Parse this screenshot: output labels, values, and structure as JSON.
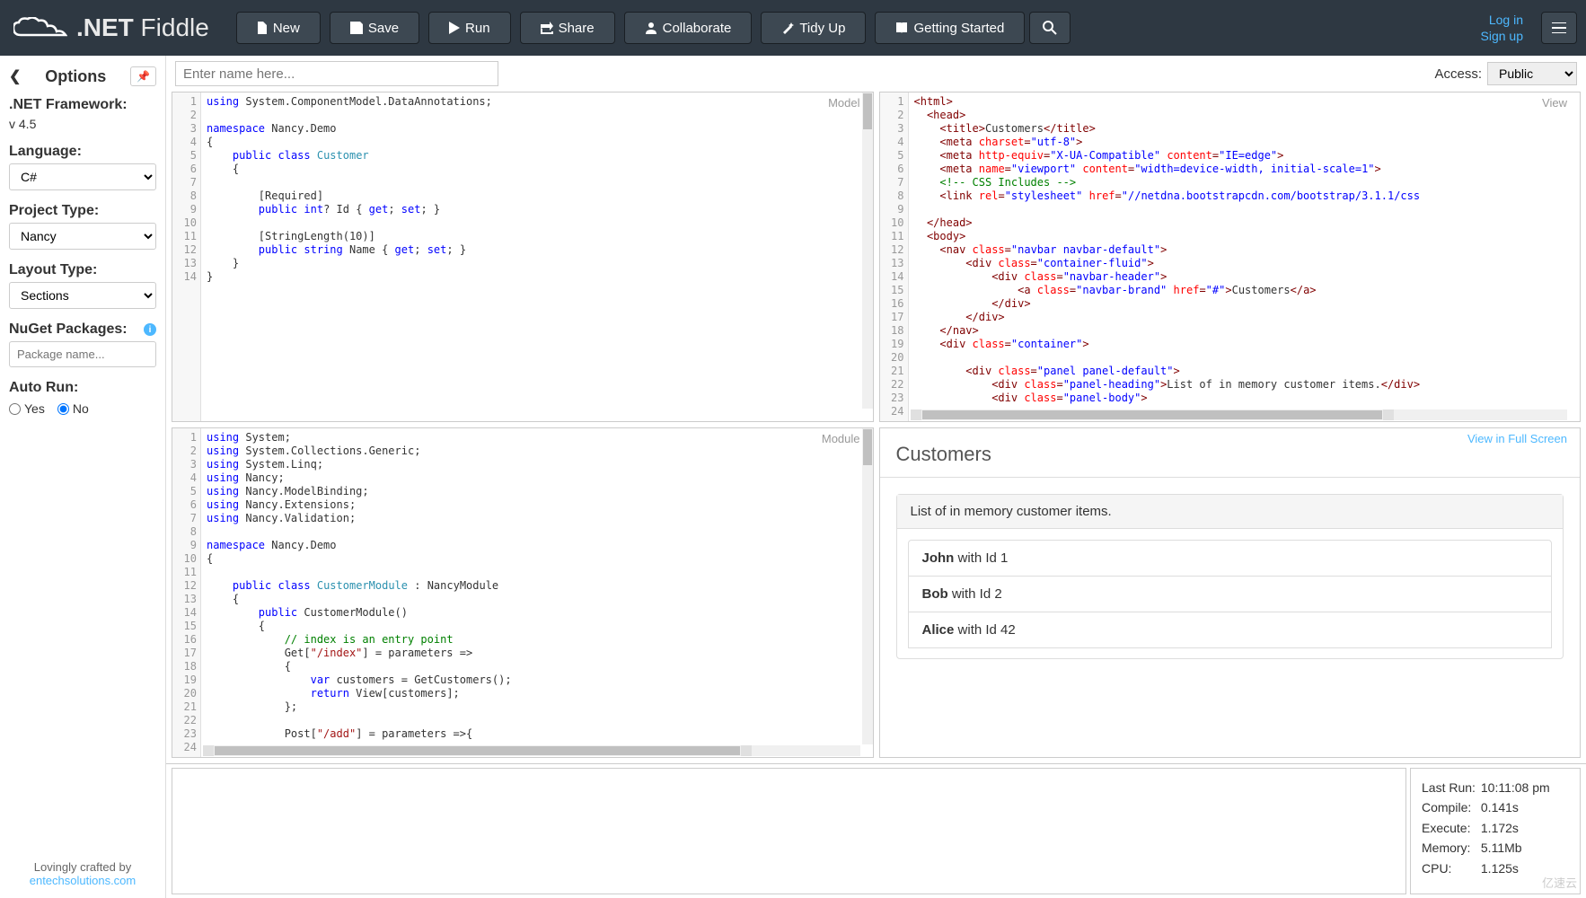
{
  "brand": {
    "name_prefix": ".NET",
    "name_suffix": " Fiddle"
  },
  "nav": {
    "new": "New",
    "save": "Save",
    "run": "Run",
    "share": "Share",
    "collaborate": "Collaborate",
    "tidyup": "Tidy Up",
    "getting_started": "Getting Started",
    "login": "Log in",
    "signup": "Sign up"
  },
  "sidebar": {
    "title": "Options",
    "framework_label": ".NET Framework:",
    "framework_value": "v 4.5",
    "language_label": "Language:",
    "language_value": "C#",
    "project_type_label": "Project Type:",
    "project_type_value": "Nancy",
    "layout_type_label": "Layout Type:",
    "layout_type_value": "Sections",
    "nuget_label": "NuGet Packages:",
    "nuget_placeholder": "Package name...",
    "autorun_label": "Auto Run:",
    "autorun_yes": "Yes",
    "autorun_no": "No",
    "footer_text": "Lovingly crafted by",
    "footer_link": "entechsolutions.com"
  },
  "topbar": {
    "name_placeholder": "Enter name here...",
    "access_label": "Access:",
    "access_value": "Public"
  },
  "panes": {
    "model_label": "Model",
    "view_label": "View",
    "module_label": "Module",
    "fullscreen_label": "View in Full Screen"
  },
  "model_code": [
    {
      "t": [
        [
          "kw",
          "using"
        ],
        [
          "",
          " System.ComponentModel.DataAnnotations;"
        ]
      ]
    },
    {
      "t": [
        [
          "",
          ""
        ]
      ]
    },
    {
      "t": [
        [
          "kw",
          "namespace"
        ],
        [
          "",
          " Nancy.Demo"
        ]
      ]
    },
    {
      "t": [
        [
          "",
          "{"
        ]
      ]
    },
    {
      "t": [
        [
          "",
          "    "
        ],
        [
          "kw",
          "public"
        ],
        [
          "",
          " "
        ],
        [
          "kw",
          "class"
        ],
        [
          "",
          " "
        ],
        [
          "typ",
          "Customer"
        ]
      ]
    },
    {
      "t": [
        [
          "",
          "    {"
        ]
      ]
    },
    {
      "t": [
        [
          "",
          ""
        ]
      ]
    },
    {
      "t": [
        [
          "",
          "        [Required]"
        ]
      ]
    },
    {
      "t": [
        [
          "",
          "        "
        ],
        [
          "kw",
          "public"
        ],
        [
          "",
          " "
        ],
        [
          "kw",
          "int"
        ],
        [
          "",
          "? Id { "
        ],
        [
          "kw",
          "get"
        ],
        [
          "",
          "; "
        ],
        [
          "kw",
          "set"
        ],
        [
          "",
          "; }"
        ]
      ]
    },
    {
      "t": [
        [
          "",
          ""
        ]
      ]
    },
    {
      "t": [
        [
          "",
          "        [StringLength(10)]"
        ]
      ]
    },
    {
      "t": [
        [
          "",
          "        "
        ],
        [
          "kw",
          "public"
        ],
        [
          "",
          " "
        ],
        [
          "kw",
          "string"
        ],
        [
          "",
          " Name { "
        ],
        [
          "kw",
          "get"
        ],
        [
          "",
          "; "
        ],
        [
          "kw",
          "set"
        ],
        [
          "",
          "; }"
        ]
      ]
    },
    {
      "t": [
        [
          "",
          "    }"
        ]
      ]
    },
    {
      "t": [
        [
          "",
          "}"
        ]
      ]
    }
  ],
  "view_code": [
    {
      "t": [
        [
          "tag",
          "<html>"
        ]
      ]
    },
    {
      "t": [
        [
          "",
          "  "
        ],
        [
          "tag",
          "<head>"
        ]
      ]
    },
    {
      "t": [
        [
          "",
          "    "
        ],
        [
          "tag",
          "<title>"
        ],
        [
          "",
          "Customers"
        ],
        [
          "tag",
          "</title>"
        ]
      ]
    },
    {
      "t": [
        [
          "",
          "    "
        ],
        [
          "tag",
          "<meta "
        ],
        [
          "attn",
          "charset"
        ],
        [
          "tag",
          "="
        ],
        [
          "attv",
          "\"utf-8\""
        ],
        [
          "tag",
          ">"
        ]
      ]
    },
    {
      "t": [
        [
          "",
          "    "
        ],
        [
          "tag",
          "<meta "
        ],
        [
          "attn",
          "http-equiv"
        ],
        [
          "tag",
          "="
        ],
        [
          "attv",
          "\"X-UA-Compatible\""
        ],
        [
          "tag",
          " "
        ],
        [
          "attn",
          "content"
        ],
        [
          "tag",
          "="
        ],
        [
          "attv",
          "\"IE=edge\""
        ],
        [
          "tag",
          ">"
        ]
      ]
    },
    {
      "t": [
        [
          "",
          "    "
        ],
        [
          "tag",
          "<meta "
        ],
        [
          "attn",
          "name"
        ],
        [
          "tag",
          "="
        ],
        [
          "attv",
          "\"viewport\""
        ],
        [
          "tag",
          " "
        ],
        [
          "attn",
          "content"
        ],
        [
          "tag",
          "="
        ],
        [
          "attv",
          "\"width=device-width, initial-scale=1\""
        ],
        [
          "tag",
          ">"
        ]
      ]
    },
    {
      "t": [
        [
          "",
          "    "
        ],
        [
          "com",
          "<!-- CSS Includes -->"
        ]
      ]
    },
    {
      "t": [
        [
          "",
          "    "
        ],
        [
          "tag",
          "<link "
        ],
        [
          "attn",
          "rel"
        ],
        [
          "tag",
          "="
        ],
        [
          "attv",
          "\"stylesheet\""
        ],
        [
          "tag",
          " "
        ],
        [
          "attn",
          "href"
        ],
        [
          "tag",
          "="
        ],
        [
          "attv",
          "\"//netdna.bootstrapcdn.com/bootstrap/3.1.1/css"
        ]
      ]
    },
    {
      "t": [
        [
          "",
          ""
        ]
      ]
    },
    {
      "t": [
        [
          "",
          "  "
        ],
        [
          "tag",
          "</head>"
        ]
      ]
    },
    {
      "t": [
        [
          "",
          "  "
        ],
        [
          "tag",
          "<body>"
        ]
      ]
    },
    {
      "t": [
        [
          "",
          "    "
        ],
        [
          "tag",
          "<nav "
        ],
        [
          "attn",
          "class"
        ],
        [
          "tag",
          "="
        ],
        [
          "attv",
          "\"navbar navbar-default\""
        ],
        [
          "tag",
          ">"
        ]
      ]
    },
    {
      "t": [
        [
          "",
          "        "
        ],
        [
          "tag",
          "<div "
        ],
        [
          "attn",
          "class"
        ],
        [
          "tag",
          "="
        ],
        [
          "attv",
          "\"container-fluid\""
        ],
        [
          "tag",
          ">"
        ]
      ]
    },
    {
      "t": [
        [
          "",
          "            "
        ],
        [
          "tag",
          "<div "
        ],
        [
          "attn",
          "class"
        ],
        [
          "tag",
          "="
        ],
        [
          "attv",
          "\"navbar-header\""
        ],
        [
          "tag",
          ">"
        ]
      ]
    },
    {
      "t": [
        [
          "",
          "                "
        ],
        [
          "tag",
          "<a "
        ],
        [
          "attn",
          "class"
        ],
        [
          "tag",
          "="
        ],
        [
          "attv",
          "\"navbar-brand\""
        ],
        [
          "tag",
          " "
        ],
        [
          "attn",
          "href"
        ],
        [
          "tag",
          "="
        ],
        [
          "attv",
          "\"#\""
        ],
        [
          "tag",
          ">"
        ],
        [
          "",
          "Customers"
        ],
        [
          "tag",
          "</a>"
        ]
      ]
    },
    {
      "t": [
        [
          "",
          "            "
        ],
        [
          "tag",
          "</div>"
        ]
      ]
    },
    {
      "t": [
        [
          "",
          "        "
        ],
        [
          "tag",
          "</div>"
        ]
      ]
    },
    {
      "t": [
        [
          "",
          "    "
        ],
        [
          "tag",
          "</nav>"
        ]
      ]
    },
    {
      "t": [
        [
          "",
          "    "
        ],
        [
          "tag",
          "<div "
        ],
        [
          "attn",
          "class"
        ],
        [
          "tag",
          "="
        ],
        [
          "attv",
          "\"container\""
        ],
        [
          "tag",
          ">"
        ]
      ]
    },
    {
      "t": [
        [
          "",
          ""
        ]
      ]
    },
    {
      "t": [
        [
          "",
          "        "
        ],
        [
          "tag",
          "<div "
        ],
        [
          "attn",
          "class"
        ],
        [
          "tag",
          "="
        ],
        [
          "attv",
          "\"panel panel-default\""
        ],
        [
          "tag",
          ">"
        ]
      ]
    },
    {
      "t": [
        [
          "",
          "            "
        ],
        [
          "tag",
          "<div "
        ],
        [
          "attn",
          "class"
        ],
        [
          "tag",
          "="
        ],
        [
          "attv",
          "\"panel-heading\""
        ],
        [
          "tag",
          ">"
        ],
        [
          "",
          "List of in memory customer items."
        ],
        [
          "tag",
          "</div>"
        ]
      ]
    },
    {
      "t": [
        [
          "",
          "            "
        ],
        [
          "tag",
          "<div "
        ],
        [
          "attn",
          "class"
        ],
        [
          "tag",
          "="
        ],
        [
          "attv",
          "\"panel-body\""
        ],
        [
          "tag",
          ">"
        ]
      ]
    },
    {
      "t": [
        [
          "",
          ""
        ]
      ]
    }
  ],
  "module_code": [
    {
      "t": [
        [
          "kw",
          "using"
        ],
        [
          "",
          " System;"
        ]
      ]
    },
    {
      "t": [
        [
          "kw",
          "using"
        ],
        [
          "",
          " System.Collections.Generic;"
        ]
      ]
    },
    {
      "t": [
        [
          "kw",
          "using"
        ],
        [
          "",
          " System.Linq;"
        ]
      ]
    },
    {
      "t": [
        [
          "kw",
          "using"
        ],
        [
          "",
          " Nancy;"
        ]
      ]
    },
    {
      "t": [
        [
          "kw",
          "using"
        ],
        [
          "",
          " Nancy.ModelBinding;"
        ]
      ]
    },
    {
      "t": [
        [
          "kw",
          "using"
        ],
        [
          "",
          " Nancy.Extensions;"
        ]
      ]
    },
    {
      "t": [
        [
          "kw",
          "using"
        ],
        [
          "",
          " Nancy.Validation;"
        ]
      ]
    },
    {
      "t": [
        [
          "",
          ""
        ]
      ]
    },
    {
      "t": [
        [
          "kw",
          "namespace"
        ],
        [
          "",
          " Nancy.Demo"
        ]
      ]
    },
    {
      "t": [
        [
          "",
          "{"
        ]
      ]
    },
    {
      "t": [
        [
          "",
          ""
        ]
      ]
    },
    {
      "t": [
        [
          "",
          "    "
        ],
        [
          "kw",
          "public"
        ],
        [
          "",
          " "
        ],
        [
          "kw",
          "class"
        ],
        [
          "",
          " "
        ],
        [
          "typ",
          "CustomerModule"
        ],
        [
          "",
          " : NancyModule"
        ]
      ]
    },
    {
      "t": [
        [
          "",
          "    {"
        ]
      ]
    },
    {
      "t": [
        [
          "",
          "        "
        ],
        [
          "kw",
          "public"
        ],
        [
          "",
          " CustomerModule()"
        ]
      ]
    },
    {
      "t": [
        [
          "",
          "        {"
        ]
      ]
    },
    {
      "t": [
        [
          "",
          "            "
        ],
        [
          "com",
          "// index is an entry point"
        ]
      ]
    },
    {
      "t": [
        [
          "",
          "            Get["
        ],
        [
          "str",
          "\"/index\""
        ],
        [
          "",
          "] = parameters =>"
        ]
      ]
    },
    {
      "t": [
        [
          "",
          "            {"
        ]
      ]
    },
    {
      "t": [
        [
          "",
          "                "
        ],
        [
          "kw",
          "var"
        ],
        [
          "",
          " customers = GetCustomers();"
        ]
      ]
    },
    {
      "t": [
        [
          "",
          "                "
        ],
        [
          "kw",
          "return"
        ],
        [
          "",
          " View[customers];"
        ]
      ]
    },
    {
      "t": [
        [
          "",
          "            };"
        ]
      ]
    },
    {
      "t": [
        [
          "",
          ""
        ]
      ]
    },
    {
      "t": [
        [
          "",
          "            Post["
        ],
        [
          "str",
          "\"/add\""
        ],
        [
          "",
          "] = parameters =>{"
        ]
      ]
    },
    {
      "t": [
        [
          "",
          ""
        ]
      ]
    }
  ],
  "preview": {
    "title": "Customers",
    "panel_heading": "List of in memory customer items.",
    "items": [
      {
        "name": "John",
        "suffix": " with Id 1"
      },
      {
        "name": "Bob",
        "suffix": " with Id 2"
      },
      {
        "name": "Alice",
        "suffix": " with Id 42"
      }
    ]
  },
  "stats": {
    "last_run_label": "Last Run:",
    "last_run": "10:11:08 pm",
    "compile_label": "Compile:",
    "compile": "0.141s",
    "execute_label": "Execute:",
    "execute": "1.172s",
    "memory_label": "Memory:",
    "memory": "5.11Mb",
    "cpu_label": "CPU:",
    "cpu": "1.125s"
  },
  "watermark": "亿速云"
}
